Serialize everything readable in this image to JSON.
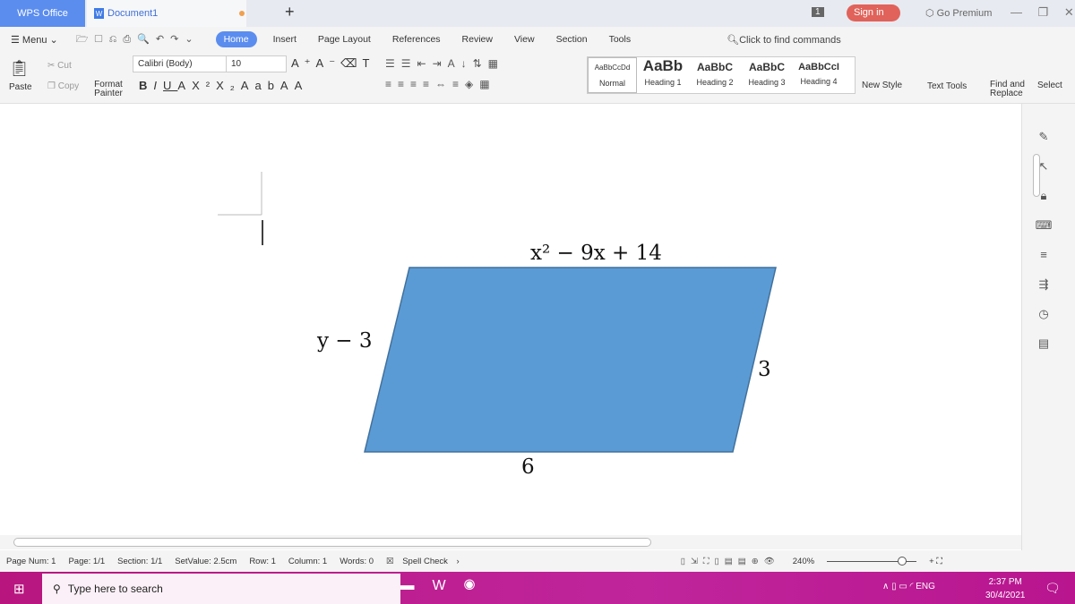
{
  "titlebar": {
    "app": "WPS Office",
    "document": "Document1",
    "new_tab": "+",
    "badge": "1",
    "sign_in": "Sign in",
    "premium": "Go Premium"
  },
  "menu": {
    "menu_label": "Menu",
    "tabs": [
      "Home",
      "Insert",
      "Page Layout",
      "References",
      "Review",
      "View",
      "Section",
      "Tools"
    ],
    "active_tab": "Home",
    "search_placeholder": "Click to find commands"
  },
  "ribbon": {
    "paste": "Paste",
    "cut": "Cut",
    "copy": "Copy",
    "format_painter": "Format Painter",
    "font": "Calibri (Body)",
    "size": "10",
    "styles": [
      {
        "preview": "AaBbCcDd",
        "name": "Normal"
      },
      {
        "preview": "AaBb",
        "name": "Heading 1"
      },
      {
        "preview": "AaBbC",
        "name": "Heading 2"
      },
      {
        "preview": "AaBbC",
        "name": "Heading 3"
      },
      {
        "preview": "AaBbCcI",
        "name": "Heading 4"
      }
    ],
    "new_style": "New Style",
    "text_tools": "Text Tools",
    "find_replace": "Find and Replace",
    "select": "Select"
  },
  "document": {
    "top_label": "x² − 9x + 14",
    "left_label": "y − 3",
    "right_label": "3",
    "bottom_label": "6",
    "shape_fill": "#5b9bd5",
    "shape_stroke": "#41719c"
  },
  "status": {
    "page_num": "Page Num: 1",
    "page": "Page: 1/1",
    "section": "Section: 1/1",
    "setvalue": "SetValue: 2.5cm",
    "row": "Row: 1",
    "column": "Column: 1",
    "words": "Words: 0",
    "spell": "Spell Check",
    "zoom": "240%"
  },
  "taskbar": {
    "search": "Type here to search",
    "time": "2:37 PM",
    "date": "30/4/2021",
    "lang": "ENG"
  },
  "colors": {
    "accent": "#5b8def",
    "signin": "#e0625a",
    "taskbar": "#b8157f"
  }
}
